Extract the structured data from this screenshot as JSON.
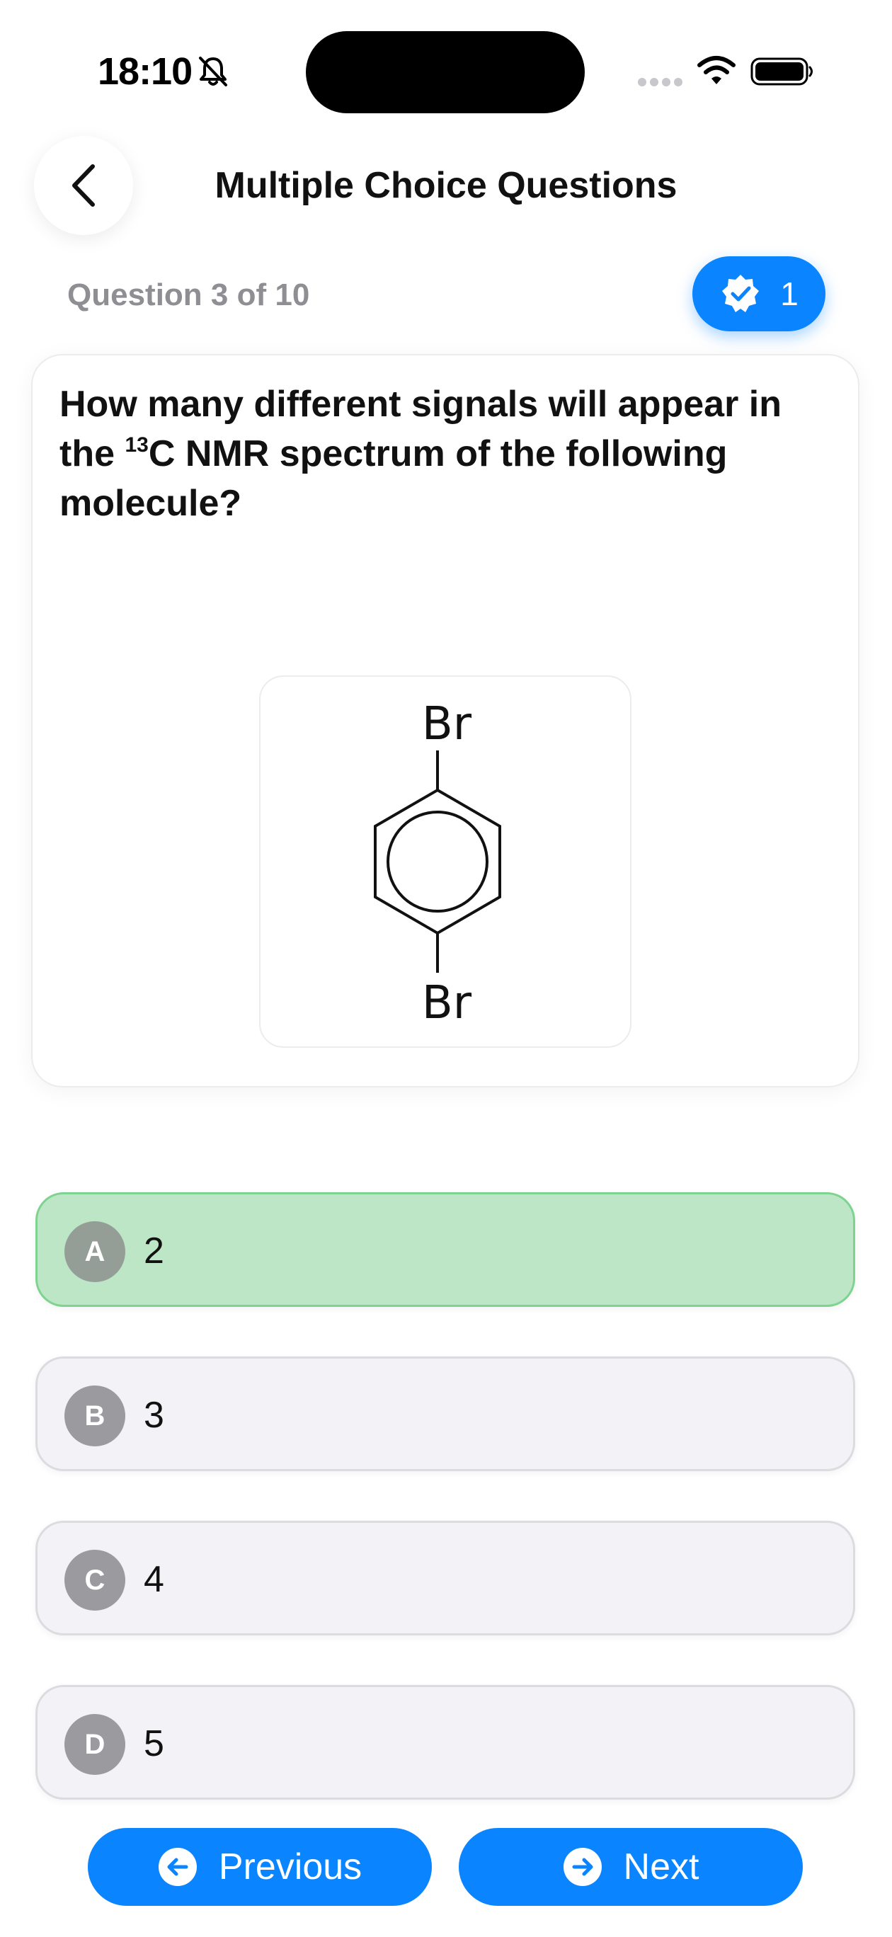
{
  "status": {
    "time": "18:10"
  },
  "header": {
    "title": "Multiple Choice Questions"
  },
  "progress": {
    "counter": "Question 3 of 10",
    "score": "1"
  },
  "question": {
    "prefix": "How many different signals will appear in the ",
    "sup": "13",
    "suffix": "C NMR spectrum of the following molecule?",
    "molecule": {
      "top_atom": "Br",
      "bottom_atom": "Br"
    }
  },
  "options": [
    {
      "letter": "A",
      "text": "2",
      "state": "correct"
    },
    {
      "letter": "B",
      "text": "3",
      "state": "default"
    },
    {
      "letter": "C",
      "text": "4",
      "state": "default"
    },
    {
      "letter": "D",
      "text": "5",
      "state": "default"
    }
  ],
  "nav": {
    "previous_label": "Previous",
    "next_label": "Next"
  },
  "colors": {
    "accent": "#0a84ff",
    "correct": "#bce6c5",
    "option_bg": "#f2f2f7"
  }
}
